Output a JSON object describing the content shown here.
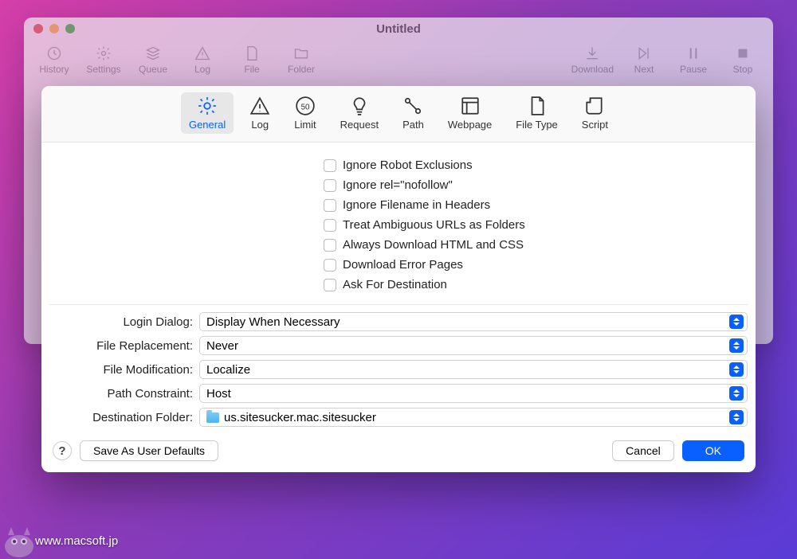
{
  "window": {
    "title": "Untitled"
  },
  "toolbar": [
    {
      "label": "History"
    },
    {
      "label": "Settings"
    },
    {
      "label": "Queue"
    },
    {
      "label": "Log"
    },
    {
      "label": "File"
    },
    {
      "label": "Folder"
    },
    {
      "label": "Download"
    },
    {
      "label": "Next"
    },
    {
      "label": "Pause"
    },
    {
      "label": "Stop"
    }
  ],
  "tabs": [
    {
      "label": "General",
      "active": true
    },
    {
      "label": "Log"
    },
    {
      "label": "Limit"
    },
    {
      "label": "Request"
    },
    {
      "label": "Path"
    },
    {
      "label": "Webpage"
    },
    {
      "label": "File Type"
    },
    {
      "label": "Script"
    }
  ],
  "checks": [
    "Ignore Robot Exclusions",
    "Ignore rel=\"nofollow\"",
    "Ignore Filename in Headers",
    "Treat Ambiguous URLs as Folders",
    "Always Download HTML and CSS",
    "Download Error Pages",
    "Ask For Destination"
  ],
  "selects": {
    "login_label": "Login Dialog:",
    "login_value": "Display When Necessary",
    "replace_label": "File Replacement:",
    "replace_value": "Never",
    "mod_label": "File Modification:",
    "mod_value": "Localize",
    "path_label": "Path Constraint:",
    "path_value": "Host",
    "dest_label": "Destination Folder:",
    "dest_value": "us.sitesucker.mac.sitesucker"
  },
  "buttons": {
    "help": "?",
    "save_defaults": "Save As User Defaults",
    "cancel": "Cancel",
    "ok": "OK"
  },
  "watermark": "www.macsoft.jp"
}
